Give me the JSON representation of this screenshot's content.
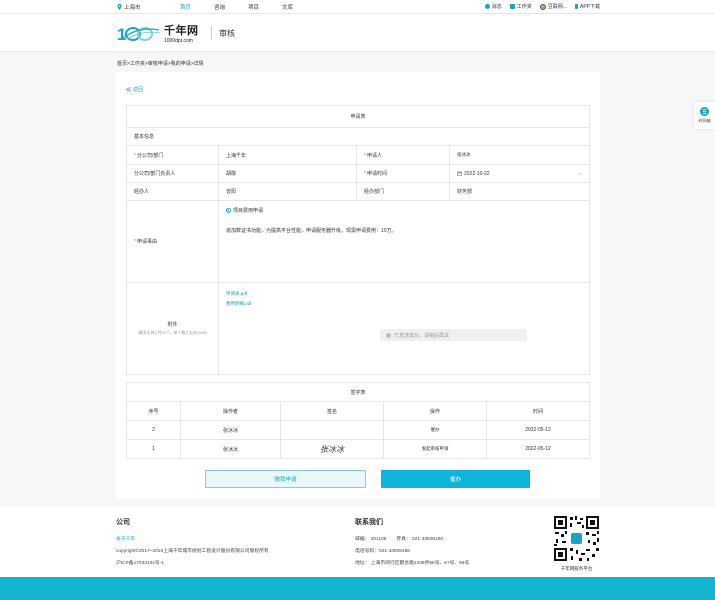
{
  "topbar": {
    "location": "上海市",
    "nav": [
      {
        "label": "首页",
        "active": true
      },
      {
        "label": "咨询",
        "active": false
      },
      {
        "label": "项目",
        "active": false
      },
      {
        "label": "文库",
        "active": false
      }
    ],
    "right": {
      "messages": "消息",
      "workbench": "工作夹",
      "user": "豆联网...",
      "app_download": "APP下载"
    }
  },
  "header": {
    "logo_title": "千年网",
    "logo_url_text": "1000dpt.com",
    "section_title": "审核"
  },
  "breadcrumb": "首页>工作夹>审核申请>我的申请>详情",
  "back_label": "返回",
  "form": {
    "caption": "申请表",
    "basic_info": "基本信息",
    "company_label": "分公司/部门",
    "company_value": "上海千年",
    "applicant_label": "申请人",
    "applicant_value": "张冰冰",
    "leader_label": "分公司/部门负责人",
    "leader_value": "胡敢",
    "time_label": "申请时间",
    "time_value": "2022-10-22",
    "handler_label": "经办人",
    "handler_value": "曾阳",
    "handler_dept_label": "经办部门",
    "handler_dept_value": "财务部",
    "reason_label": "申请事由",
    "reason_type": "项目费用申请",
    "reason_text": "追加数证书功能，为提高平台性能，申请服务器升级，现需申请费用：10万。",
    "attach_label": "附件",
    "attach_hint": "(最多支持上传10个，单个最大支持200M)",
    "files": [
      "申请表.pdf",
      "费用明细.pdf"
    ],
    "tip": "已发送成功，请稍后再试"
  },
  "sign_table": {
    "caption": "签字表",
    "headers": [
      "序号",
      "操作者",
      "签名",
      "操作",
      "时间"
    ],
    "rows": [
      {
        "no": "2",
        "operator": "张冰冰",
        "signature": "",
        "action": "催办",
        "time": "2022-05-12"
      },
      {
        "no": "1",
        "operator": "张冰冰",
        "signature": "张冰冰",
        "action": "发起审核申请",
        "time": "2022-05-12"
      }
    ]
  },
  "buttons": {
    "revoke": "撤销申请",
    "urge": "催办"
  },
  "side_tab": "时间轴",
  "footer": {
    "company_heading": "公司",
    "about": "关于千年",
    "copyright": "copyright©2017~2019上海千年城市规划工程设计股份有限公司版权所有",
    "icp": "沪ICP备17033132号-1",
    "contact_heading": "联系我们",
    "postcode": "邮编： 201106",
    "fax": "传真： 021-33508160",
    "phone": "电话号码：021-33508186",
    "address": "地址： 上海市闵行区都会路2338弄66号、67号、94号",
    "qr_caption": "千年网服务平台"
  },
  "colors": {
    "accent": "#1aa3c9",
    "primary_button": "#0fb5d8",
    "bottom_bar": "#14b3cf"
  }
}
